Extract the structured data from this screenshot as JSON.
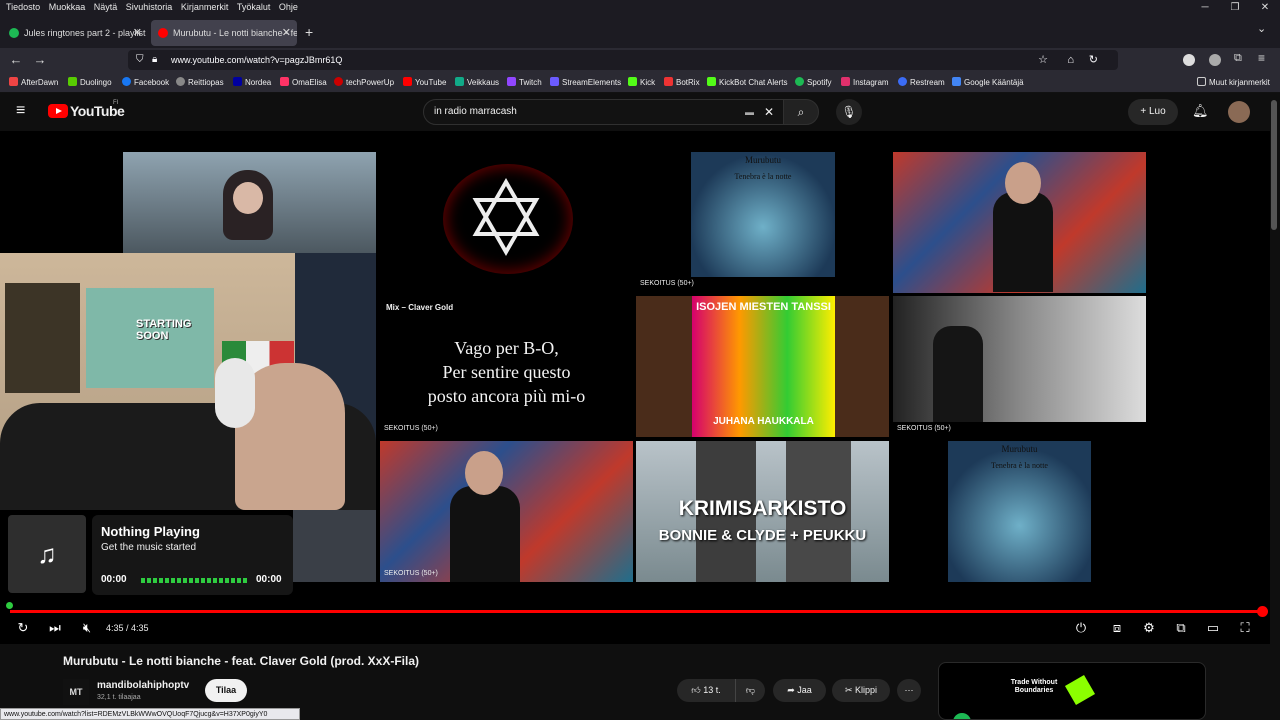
{
  "menubar": {
    "items": [
      "Tiedosto",
      "Muokkaa",
      "Näytä",
      "Sivuhistoria",
      "Kirjanmerkit",
      "Työkalut",
      "Ohje"
    ]
  },
  "tabs": [
    {
      "label": "Jules ringtones part 2 - playlist",
      "active": false,
      "favicon_color": "#1db954"
    },
    {
      "label": "Murubutu - Le notti bianche - fe",
      "active": true,
      "favicon_color": "#ff0000"
    }
  ],
  "navbar": {
    "url": "www.youtube.com/watch?v=pagzJBmr61Q"
  },
  "bookmarks": [
    {
      "label": "AfterDawn",
      "color": "#e44"
    },
    {
      "label": "Duolingo",
      "color": "#58cc02"
    },
    {
      "label": "Facebook",
      "color": "#1877f2"
    },
    {
      "label": "Reittiopas",
      "color": "#888"
    },
    {
      "label": "Nordea",
      "color": "#0000a0"
    },
    {
      "label": "OmaElisa",
      "color": "#f36"
    },
    {
      "label": "techPowerUp",
      "color": "#c00"
    },
    {
      "label": "YouTube",
      "color": "#f00"
    },
    {
      "label": "Veikkaus",
      "color": "#1a8"
    },
    {
      "label": "Twitch",
      "color": "#9146ff"
    },
    {
      "label": "StreamElements",
      "color": "#6b5bff"
    },
    {
      "label": "Kick",
      "color": "#53fc18"
    },
    {
      "label": "BotRix",
      "color": "#e33"
    },
    {
      "label": "KickBot Chat Alerts",
      "color": "#53fc18"
    },
    {
      "label": "Spotify",
      "color": "#1db954"
    },
    {
      "label": "Instagram",
      "color": "#e1306c"
    },
    {
      "label": "Restream",
      "color": "#3b6cf6"
    },
    {
      "label": "Google Kääntäjä",
      "color": "#4285f4"
    }
  ],
  "bookmarks_other": "Muut kirjanmerkit",
  "youtube": {
    "logo_text": "YouTube",
    "logo_region": "FI",
    "search_value": "in radio marracash",
    "create_label": "Luo"
  },
  "video_overlay": {
    "mix_label": "Mix – Claver Gold",
    "lyric_lines": [
      "Vago per B-O,",
      "Per sentire questo",
      "posto ancora più mi-o"
    ],
    "badge": "SEKOITUS (50+)",
    "thumb_texts": {
      "murubutu_top": "Murubutu",
      "murubutu_sub": "Tenebra è la notte",
      "isojen": "ISOJEN MIESTEN TANSSI",
      "juhana": "JUHANA HAUKKALA",
      "krimi": "KRIMISARKISTO",
      "bonnie": "BONNIE & CLYDE + PEUKKU"
    }
  },
  "music_widget": {
    "title": "Nothing Playing",
    "subtitle": "Get the music started",
    "time_start": "00:00",
    "time_end": "00:00"
  },
  "player": {
    "time": "4:35 / 4:35",
    "progress_fraction": 1.0
  },
  "video_info": {
    "title": "Murubutu - Le notti bianche - feat. Claver Gold (prod. XxX-Fila)",
    "channel": "mandibolahiphoptv",
    "subscribers": "32,1 t. tilaajaa",
    "subscribe_label": "Tilaa",
    "likes": "13 t.",
    "share_label": "Jaa",
    "clip_label": "Klippi"
  },
  "ad": {
    "text": "Trade Without Boundaries"
  },
  "statusbar": {
    "url": "www.youtube.com/watch?list=RDEMzVLBkWWwOVQUoqF7Qjucg&v=H37XP0giyY0"
  },
  "colors": {
    "accent_red": "#ff0000",
    "widget_green": "#2ecc40"
  }
}
